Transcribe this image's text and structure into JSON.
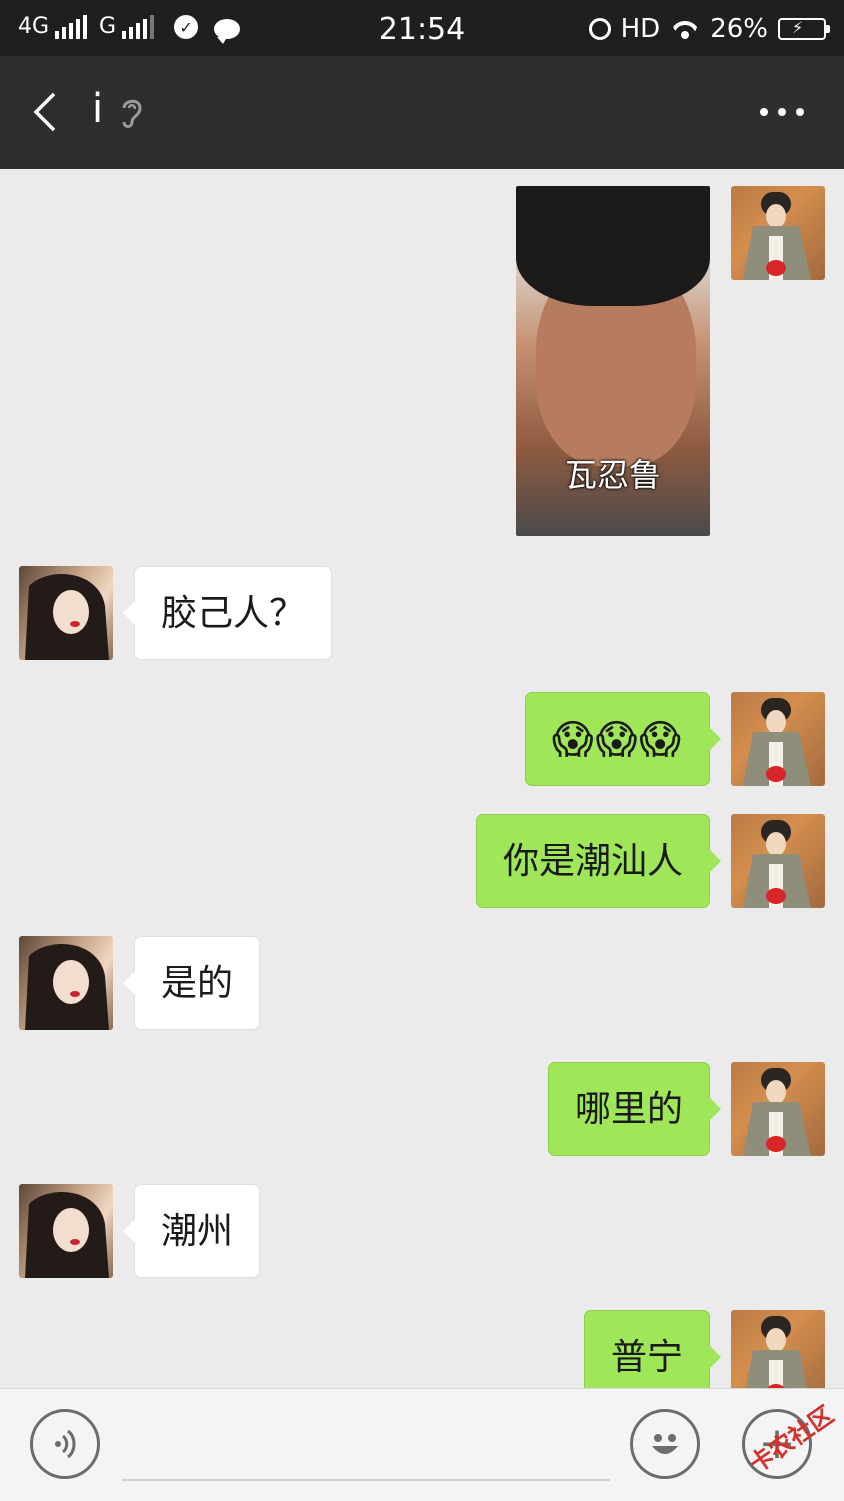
{
  "status_bar": {
    "network1": "4G",
    "network2": "G",
    "time": "21:54",
    "hd": "HD",
    "battery_percent": "26%",
    "battery_level": 0.26
  },
  "header": {
    "title": "i",
    "icons": [
      "back-arrow-icon",
      "earpiece-icon",
      "more-icon"
    ]
  },
  "messages": [
    {
      "from": "me",
      "type": "image",
      "caption": "瓦忍鲁"
    },
    {
      "from": "them",
      "type": "text",
      "text": "胶己人？"
    },
    {
      "from": "me",
      "type": "emoji",
      "text": "😱😱😱"
    },
    {
      "from": "me",
      "type": "text",
      "text": "你是潮汕人"
    },
    {
      "from": "them",
      "type": "text",
      "text": "是的"
    },
    {
      "from": "me",
      "type": "text",
      "text": "哪里的"
    },
    {
      "from": "them",
      "type": "text",
      "text": "潮州"
    },
    {
      "from": "me",
      "type": "text",
      "text": "普宁"
    }
  ],
  "input_bar": {
    "text_value": "",
    "watermark": "卡农社区"
  },
  "colors": {
    "my_bubble": "#9fe658",
    "their_bubble": "#ffffff",
    "chat_bg": "#ebebeb",
    "header_bg": "#2e2e2e"
  }
}
